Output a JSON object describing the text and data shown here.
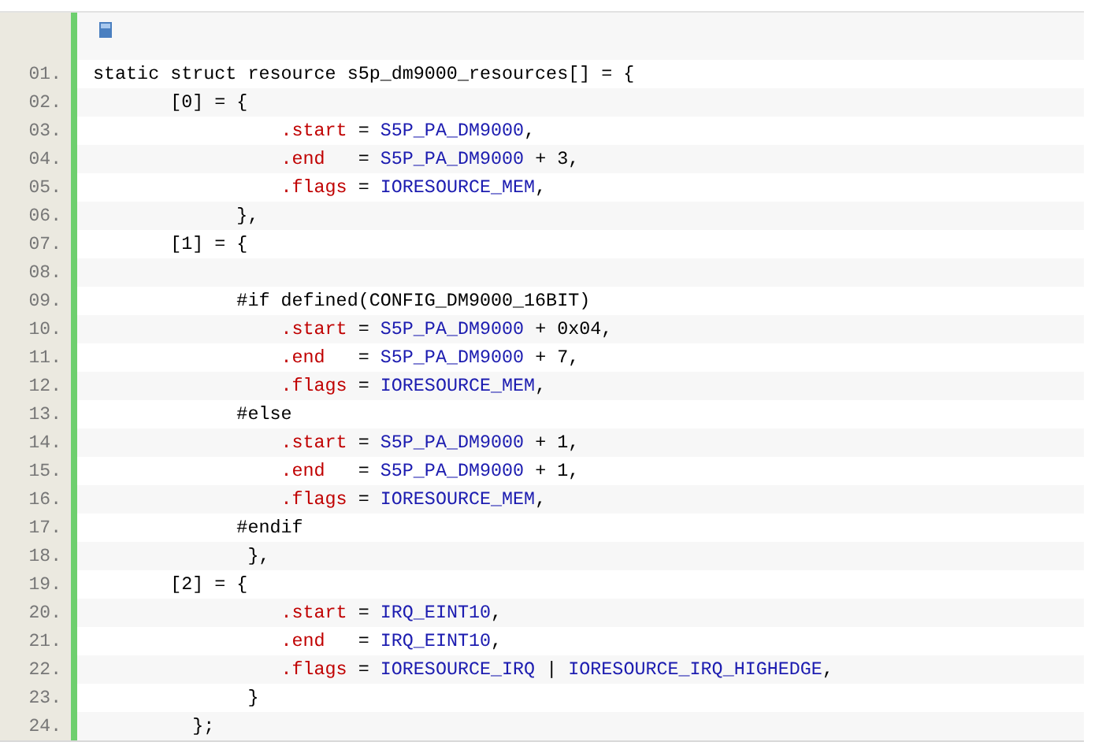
{
  "code_block": {
    "lines": [
      {
        "number": "01.",
        "segments": [
          {
            "kind": "plain",
            "text": "static struct resource s5p_dm9000_resources[] = {"
          }
        ]
      },
      {
        "number": "02.",
        "segments": [
          {
            "kind": "plain",
            "text": "       [0] = {"
          }
        ]
      },
      {
        "number": "03.",
        "segments": [
          {
            "kind": "field",
            "text": "                 .start"
          },
          {
            "kind": "plain",
            "text": " = "
          },
          {
            "kind": "value",
            "text": "S5P_PA_DM9000"
          },
          {
            "kind": "plain",
            "text": ","
          }
        ]
      },
      {
        "number": "04.",
        "segments": [
          {
            "kind": "field",
            "text": "                 .end"
          },
          {
            "kind": "plain",
            "text": "   = "
          },
          {
            "kind": "value",
            "text": "S5P_PA_DM9000"
          },
          {
            "kind": "plain",
            "text": " + 3,"
          }
        ]
      },
      {
        "number": "05.",
        "segments": [
          {
            "kind": "field",
            "text": "                 .flags"
          },
          {
            "kind": "plain",
            "text": " = "
          },
          {
            "kind": "value",
            "text": "IORESOURCE_MEM"
          },
          {
            "kind": "plain",
            "text": ","
          }
        ]
      },
      {
        "number": "06.",
        "segments": [
          {
            "kind": "plain",
            "text": "             },"
          }
        ]
      },
      {
        "number": "07.",
        "segments": [
          {
            "kind": "plain",
            "text": "       [1] = {"
          }
        ]
      },
      {
        "number": "08."
      },
      {
        "number": "09.",
        "segments": [
          {
            "kind": "plain",
            "text": "             #if defined(CONFIG_DM9000_16BIT)"
          }
        ]
      },
      {
        "number": "10.",
        "segments": [
          {
            "kind": "field",
            "text": "                 .start"
          },
          {
            "kind": "plain",
            "text": " = "
          },
          {
            "kind": "value",
            "text": "S5P_PA_DM9000"
          },
          {
            "kind": "plain",
            "text": " + 0x04,"
          }
        ]
      },
      {
        "number": "11.",
        "segments": [
          {
            "kind": "field",
            "text": "                 .end"
          },
          {
            "kind": "plain",
            "text": "   = "
          },
          {
            "kind": "value",
            "text": "S5P_PA_DM9000"
          },
          {
            "kind": "plain",
            "text": " + 7,"
          }
        ]
      },
      {
        "number": "12.",
        "segments": [
          {
            "kind": "field",
            "text": "                 .flags"
          },
          {
            "kind": "plain",
            "text": " = "
          },
          {
            "kind": "value",
            "text": "IORESOURCE_MEM"
          },
          {
            "kind": "plain",
            "text": ","
          }
        ]
      },
      {
        "number": "13.",
        "segments": [
          {
            "kind": "plain",
            "text": "             #else"
          }
        ]
      },
      {
        "number": "14.",
        "segments": [
          {
            "kind": "field",
            "text": "                 .start"
          },
          {
            "kind": "plain",
            "text": " = "
          },
          {
            "kind": "value",
            "text": "S5P_PA_DM9000"
          },
          {
            "kind": "plain",
            "text": " + 1,"
          }
        ]
      },
      {
        "number": "15.",
        "segments": [
          {
            "kind": "field",
            "text": "                 .end"
          },
          {
            "kind": "plain",
            "text": "   = "
          },
          {
            "kind": "value",
            "text": "S5P_PA_DM9000"
          },
          {
            "kind": "plain",
            "text": " + 1,"
          }
        ]
      },
      {
        "number": "16.",
        "segments": [
          {
            "kind": "field",
            "text": "                 .flags"
          },
          {
            "kind": "plain",
            "text": " = "
          },
          {
            "kind": "value",
            "text": "IORESOURCE_MEM"
          },
          {
            "kind": "plain",
            "text": ","
          }
        ]
      },
      {
        "number": "17.",
        "segments": [
          {
            "kind": "plain",
            "text": "             #endif"
          }
        ]
      },
      {
        "number": "18.",
        "segments": [
          {
            "kind": "plain",
            "text": "              },"
          }
        ]
      },
      {
        "number": "19.",
        "segments": [
          {
            "kind": "plain",
            "text": "       [2] = {"
          }
        ]
      },
      {
        "number": "20.",
        "segments": [
          {
            "kind": "field",
            "text": "                 .start"
          },
          {
            "kind": "plain",
            "text": " = "
          },
          {
            "kind": "value",
            "text": "IRQ_EINT10"
          },
          {
            "kind": "plain",
            "text": ","
          }
        ]
      },
      {
        "number": "21.",
        "segments": [
          {
            "kind": "field",
            "text": "                 .end"
          },
          {
            "kind": "plain",
            "text": "   = "
          },
          {
            "kind": "value",
            "text": "IRQ_EINT10"
          },
          {
            "kind": "plain",
            "text": ","
          }
        ]
      },
      {
        "number": "22.",
        "segments": [
          {
            "kind": "field",
            "text": "                 .flags"
          },
          {
            "kind": "plain",
            "text": " = "
          },
          {
            "kind": "value",
            "text": "IORESOURCE_IRQ"
          },
          {
            "kind": "plain",
            "text": " | "
          },
          {
            "kind": "value",
            "text": "IORESOURCE_IRQ_HIGHEDGE"
          },
          {
            "kind": "plain",
            "text": ","
          }
        ]
      },
      {
        "number": "23.",
        "segments": [
          {
            "kind": "plain",
            "text": "              }"
          }
        ]
      },
      {
        "number": "24.",
        "segments": [
          {
            "kind": "plain",
            "text": "         };"
          }
        ]
      }
    ]
  }
}
